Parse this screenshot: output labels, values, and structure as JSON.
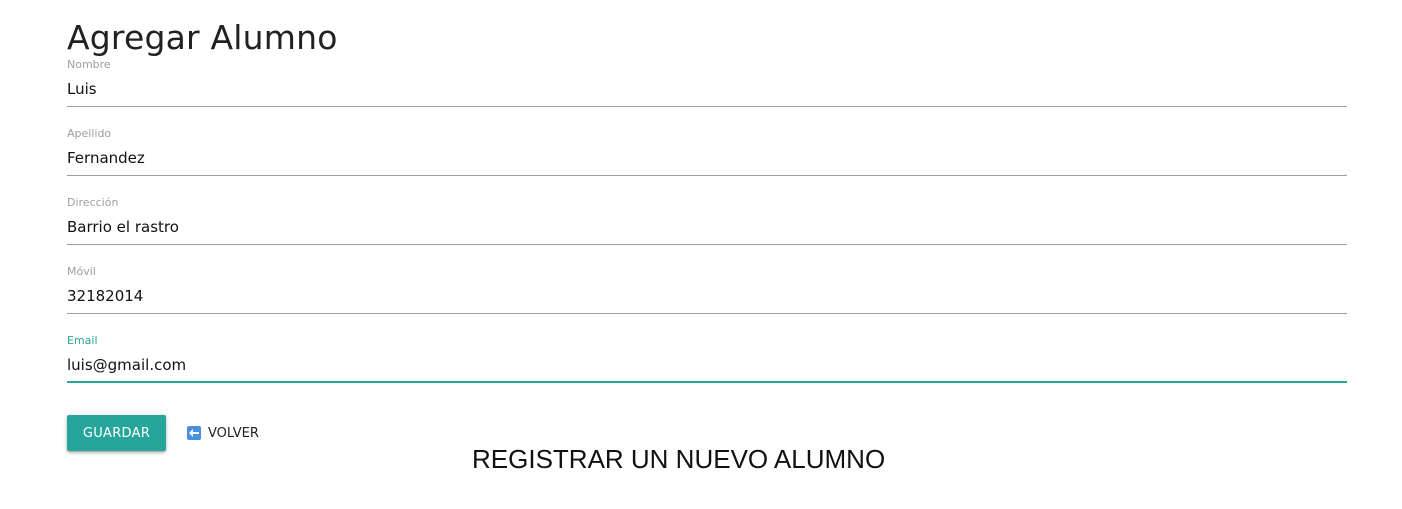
{
  "page": {
    "title": "Agregar Alumno",
    "banner": "REGISTRAR UN NUEVO ALUMNO"
  },
  "form": {
    "nombre": {
      "label": "Nombre",
      "value": "Luis"
    },
    "apellido": {
      "label": "Apellido",
      "value": "Fernandez"
    },
    "direccion": {
      "label": "Dirección",
      "value": "Barrio el rastro"
    },
    "movil": {
      "label": "Móvil",
      "value": "32182014"
    },
    "email": {
      "label": "Email",
      "value": "luis@gmail.com",
      "focused": true
    }
  },
  "actions": {
    "save_label": "GUARDAR",
    "back_label": "VOLVER",
    "back_icon": "arrow-left-icon"
  },
  "colors": {
    "accent": "#26a69a",
    "underline": "#9e9e9e",
    "label": "#9e9e9e",
    "back_icon": "#4a90e2"
  }
}
